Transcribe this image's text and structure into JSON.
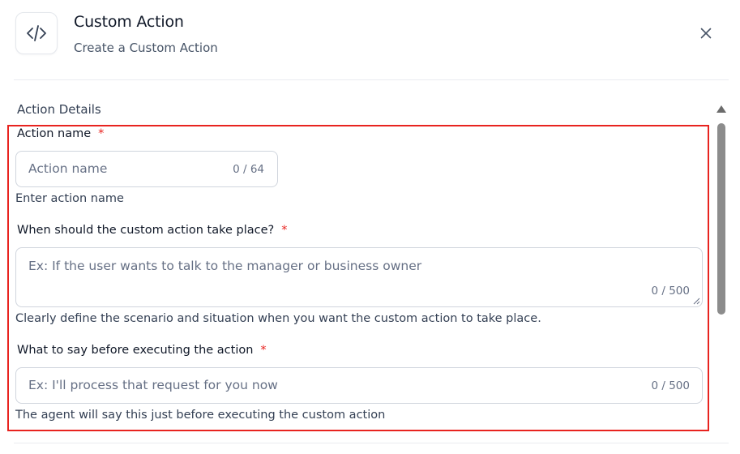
{
  "header": {
    "title": "Custom Action",
    "subtitle": "Create a Custom Action",
    "icon": "code-icon"
  },
  "section": {
    "title": "Action Details"
  },
  "fields": {
    "action_name": {
      "label": "Action name",
      "required_mark": "*",
      "placeholder": "Action name",
      "counter": "0 / 64",
      "helper": "Enter action name"
    },
    "when": {
      "label": "When should the custom action take place?",
      "required_mark": "*",
      "placeholder": "Ex: If the user wants to talk to the manager or business owner",
      "counter": "0 / 500",
      "helper": "Clearly define the scenario and situation when you want the custom action to take place."
    },
    "say_before": {
      "label": "What to say before executing the action",
      "required_mark": "*",
      "placeholder": "Ex: I'll process that request for you now",
      "counter": "0 / 500",
      "helper": "The agent will say this just before executing the custom action"
    }
  },
  "colors": {
    "highlight": "#e8231f",
    "required": "#e8231f",
    "border": "#d0d5dd",
    "muted_text": "#667085"
  }
}
